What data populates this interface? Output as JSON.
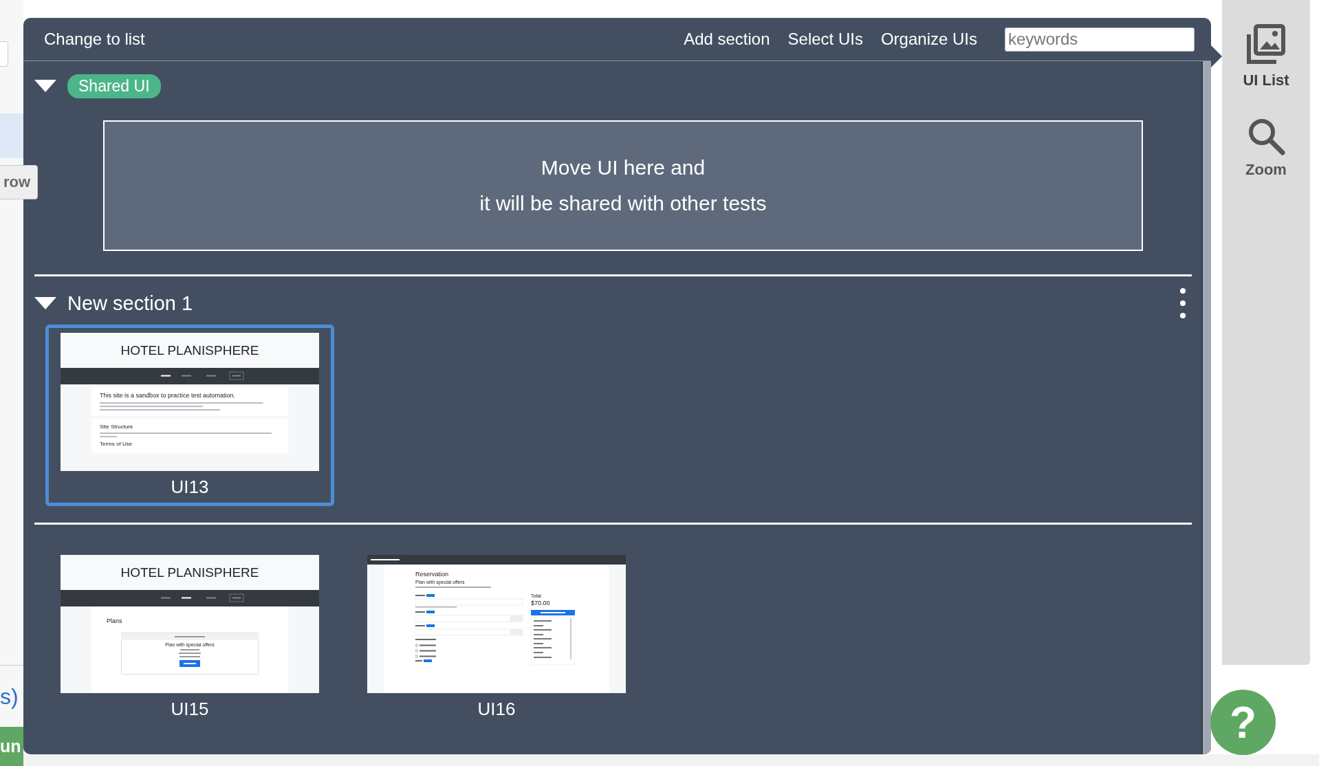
{
  "page_edge": {
    "side_button": "row",
    "link": "s)",
    "run_button": "un"
  },
  "ui_panel": {
    "toolbar": {
      "toggle": "Change to list",
      "actions": [
        "Add section",
        "Select UIs",
        "Organize UIs"
      ],
      "search": {
        "placeholder": "keywords"
      }
    },
    "sections": [
      {
        "kind": "shared",
        "expanded": true,
        "badge": "Shared UI",
        "drop_zone": [
          "Move UI here and",
          "it will be shared with other tests"
        ]
      },
      {
        "kind": "named",
        "expanded": true,
        "title": "New section 1",
        "items": [
          {
            "label": "UI13",
            "selected": true,
            "screen": {
              "kind": "home",
              "title": "HOTEL PLANISPHERE",
              "headings": [
                "This site is a sandbox to practice test automation.",
                "Site Structure",
                "Terms of Use"
              ]
            }
          }
        ]
      },
      {
        "kind": "unnamed",
        "items": [
          {
            "label": "UI15",
            "selected": false,
            "screen": {
              "kind": "plans",
              "title": "HOTEL PLANISPHERE",
              "heading": "Plans",
              "plan": "Plan with special offers"
            }
          },
          {
            "label": "UI16",
            "selected": false,
            "screen": {
              "kind": "reservation",
              "heading": "Reservation",
              "plan": "Plan with special offers",
              "total_label": "Total",
              "total": "$70.00"
            }
          }
        ]
      }
    ]
  },
  "side_toolbar": [
    {
      "kind": "ui_list",
      "label": "UI List",
      "selected": true
    },
    {
      "kind": "zoom",
      "label": "Zoom",
      "selected": false
    }
  ],
  "help_button": {
    "label": "?"
  }
}
